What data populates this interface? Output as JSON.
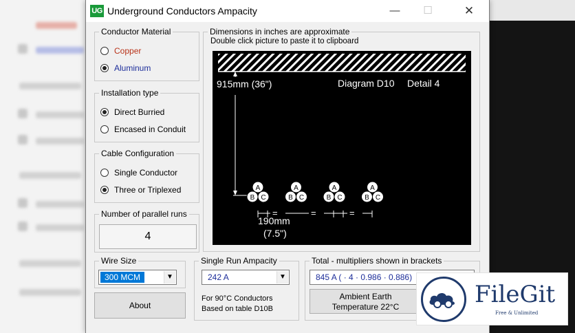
{
  "window": {
    "icon_text": "UG",
    "title": "Underground Conductors Ampacity",
    "minimize_glyph": "—",
    "maximize_glyph": "☐",
    "close_glyph": "✕"
  },
  "conductor_material": {
    "legend": "Conductor Material",
    "options": [
      {
        "label": "Copper",
        "checked": false,
        "color": "#b83218"
      },
      {
        "label": "Aluminum",
        "checked": true,
        "color": "#1c2d9a"
      }
    ]
  },
  "installation_type": {
    "legend": "Installation type",
    "options": [
      {
        "label": "Direct Burried",
        "checked": true
      },
      {
        "label": "Encased in Conduit",
        "checked": false
      }
    ]
  },
  "cable_configuration": {
    "legend": "Cable Configuration",
    "options": [
      {
        "label": "Single Conductor",
        "checked": false
      },
      {
        "label": "Three or Triplexed",
        "checked": true
      }
    ]
  },
  "parallel_runs": {
    "legend": "Number of parallel runs",
    "value": "4"
  },
  "diagram": {
    "legend_line1": "Dimensions in inches are approximate",
    "legend_line2": "Double click picture to paste it to clipboard",
    "depth_label": "915mm (36\")",
    "diagram_label": "Diagram D10",
    "detail_label": "Detail 4",
    "spacing_label_mm": "190mm",
    "spacing_label_in": "(7.5\")",
    "equal_sign": "=",
    "phase_labels": [
      "A",
      "B",
      "C"
    ],
    "cable_groups": 4
  },
  "wire_size": {
    "legend": "Wire Size",
    "value": "300 MCM"
  },
  "about_button": {
    "label": "About"
  },
  "single_run": {
    "legend": "Single Run Ampacity",
    "value": "242 A",
    "note_line1": "For 90°C Conductors",
    "note_line2": "Based on table D10B"
  },
  "total": {
    "legend": "Total - multipliers shown in brackets",
    "value": "845 A ( · 4 · 0.986 · 0.886)",
    "ambient_line1": "Ambient Earth",
    "ambient_line2": "Temperature 22°C"
  },
  "watermark": {
    "name": "FileGit",
    "tagline": "Free & Unlimited"
  },
  "colors": {
    "accent_selected": "#0078d7",
    "app_icon_green": "#1a9a3a",
    "copper_red": "#b83218",
    "aluminum_blue": "#1c2d9a",
    "watermark_navy": "#1f3a6c"
  }
}
